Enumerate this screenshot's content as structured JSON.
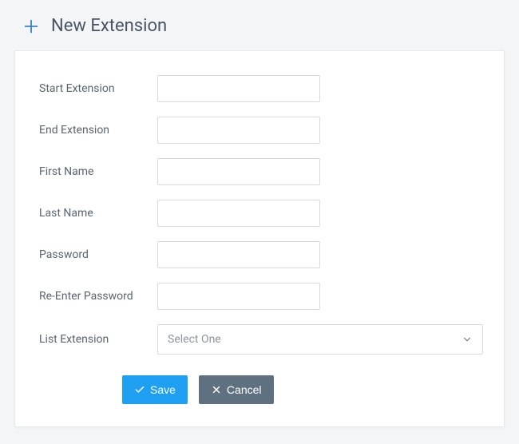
{
  "header": {
    "title": "New Extension"
  },
  "form": {
    "fields": {
      "start_extension": {
        "label": "Start Extension",
        "value": ""
      },
      "end_extension": {
        "label": "End Extension",
        "value": ""
      },
      "first_name": {
        "label": "First Name",
        "value": ""
      },
      "last_name": {
        "label": "Last Name",
        "value": ""
      },
      "password": {
        "label": "Password",
        "value": ""
      },
      "re_enter_password": {
        "label": "Re-Enter Password",
        "value": ""
      },
      "list_extension": {
        "label": "List Extension",
        "selected": "Select One"
      }
    }
  },
  "buttons": {
    "save": "Save",
    "cancel": "Cancel"
  }
}
